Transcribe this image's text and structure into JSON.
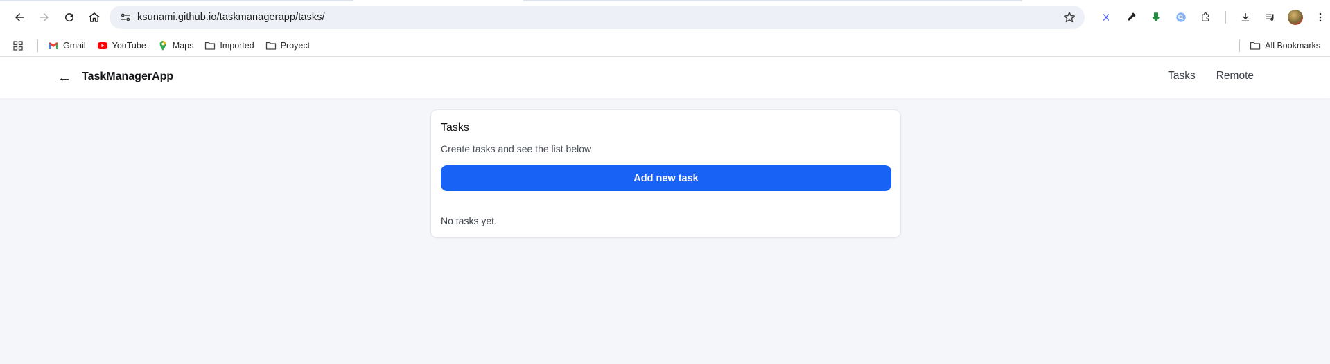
{
  "browser": {
    "url": "ksunami.github.io/taskmanagerapp/tasks/",
    "bookmarks": [
      {
        "label": "Gmail",
        "icon": "gmail-icon"
      },
      {
        "label": "YouTube",
        "icon": "youtube-icon"
      },
      {
        "label": "Maps",
        "icon": "maps-icon"
      },
      {
        "label": "Imported",
        "icon": "folder-icon"
      },
      {
        "label": "Proyect",
        "icon": "folder-icon"
      }
    ],
    "all_bookmarks_label": "All Bookmarks",
    "colors": {
      "omnibox_bg": "#edf0f7",
      "ext_green": "#1e8e3e",
      "ext_blue": "#4f7cf3"
    }
  },
  "app": {
    "brand": "TaskManagerApp",
    "back_glyph": "←",
    "nav": [
      "Tasks",
      "Remote"
    ]
  },
  "tasks_card": {
    "title": "Tasks",
    "subtitle": "Create tasks and see the list below",
    "add_button_label": "Add new task",
    "empty_message": "No tasks yet.",
    "accent_color": "#1962f6"
  }
}
